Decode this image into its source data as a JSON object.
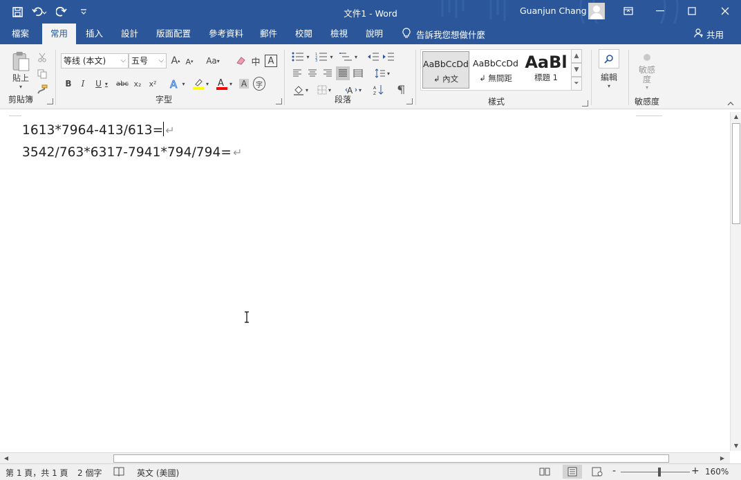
{
  "titlebar": {
    "title": "文件1  -  Word",
    "user": "Guanjun Chang",
    "qat": [
      "save-icon",
      "undo-icon",
      "redo-icon",
      "customize-qat-icon"
    ]
  },
  "tabs": [
    {
      "label": "檔案"
    },
    {
      "label": "常用"
    },
    {
      "label": "插入"
    },
    {
      "label": "設計"
    },
    {
      "label": "版面配置"
    },
    {
      "label": "參考資料"
    },
    {
      "label": "郵件"
    },
    {
      "label": "校閱"
    },
    {
      "label": "檢視"
    },
    {
      "label": "說明"
    }
  ],
  "tellme": "告訴我您想做什麼",
  "share": "共用",
  "ribbon": {
    "clipboard": {
      "paste": "貼上",
      "label": "剪貼簿"
    },
    "font": {
      "name": "等线 (本文)",
      "size": "五号",
      "label": "字型",
      "grow": "A",
      "shrink": "A",
      "case": "Aa",
      "bold": "B",
      "italic": "I",
      "underline": "U",
      "strike": "abc",
      "sub": "x₂",
      "sup": "x²",
      "pinyin": "中",
      "border_char": "A",
      "shade_char": "A",
      "enclose": "字"
    },
    "paragraph": {
      "label": "段落"
    },
    "styles": {
      "label": "樣式",
      "items": [
        {
          "preview": "AaBbCcDd",
          "name": "↲ 內文"
        },
        {
          "preview": "AaBbCcDd",
          "name": "↲ 無間距"
        },
        {
          "preview": "AaBl",
          "name": "標題 1"
        }
      ]
    },
    "editing": {
      "label": "編輯"
    },
    "sensitivity": {
      "button": "敏感度",
      "label": "敏感度"
    }
  },
  "document": {
    "lines": [
      "1613*7964-413/613=",
      "3542/763*6317-7941*794/794="
    ],
    "para_mark": "↵"
  },
  "status": {
    "page": "第 1 頁，共 1 頁",
    "words": "2 個字",
    "language": "英文 (美國)",
    "zoom": "160%",
    "zoom_minus": "-",
    "zoom_plus": "+"
  },
  "colors": {
    "accent": "#2b579a",
    "highlight": "#ffff00",
    "font_color": "#ff0000"
  }
}
